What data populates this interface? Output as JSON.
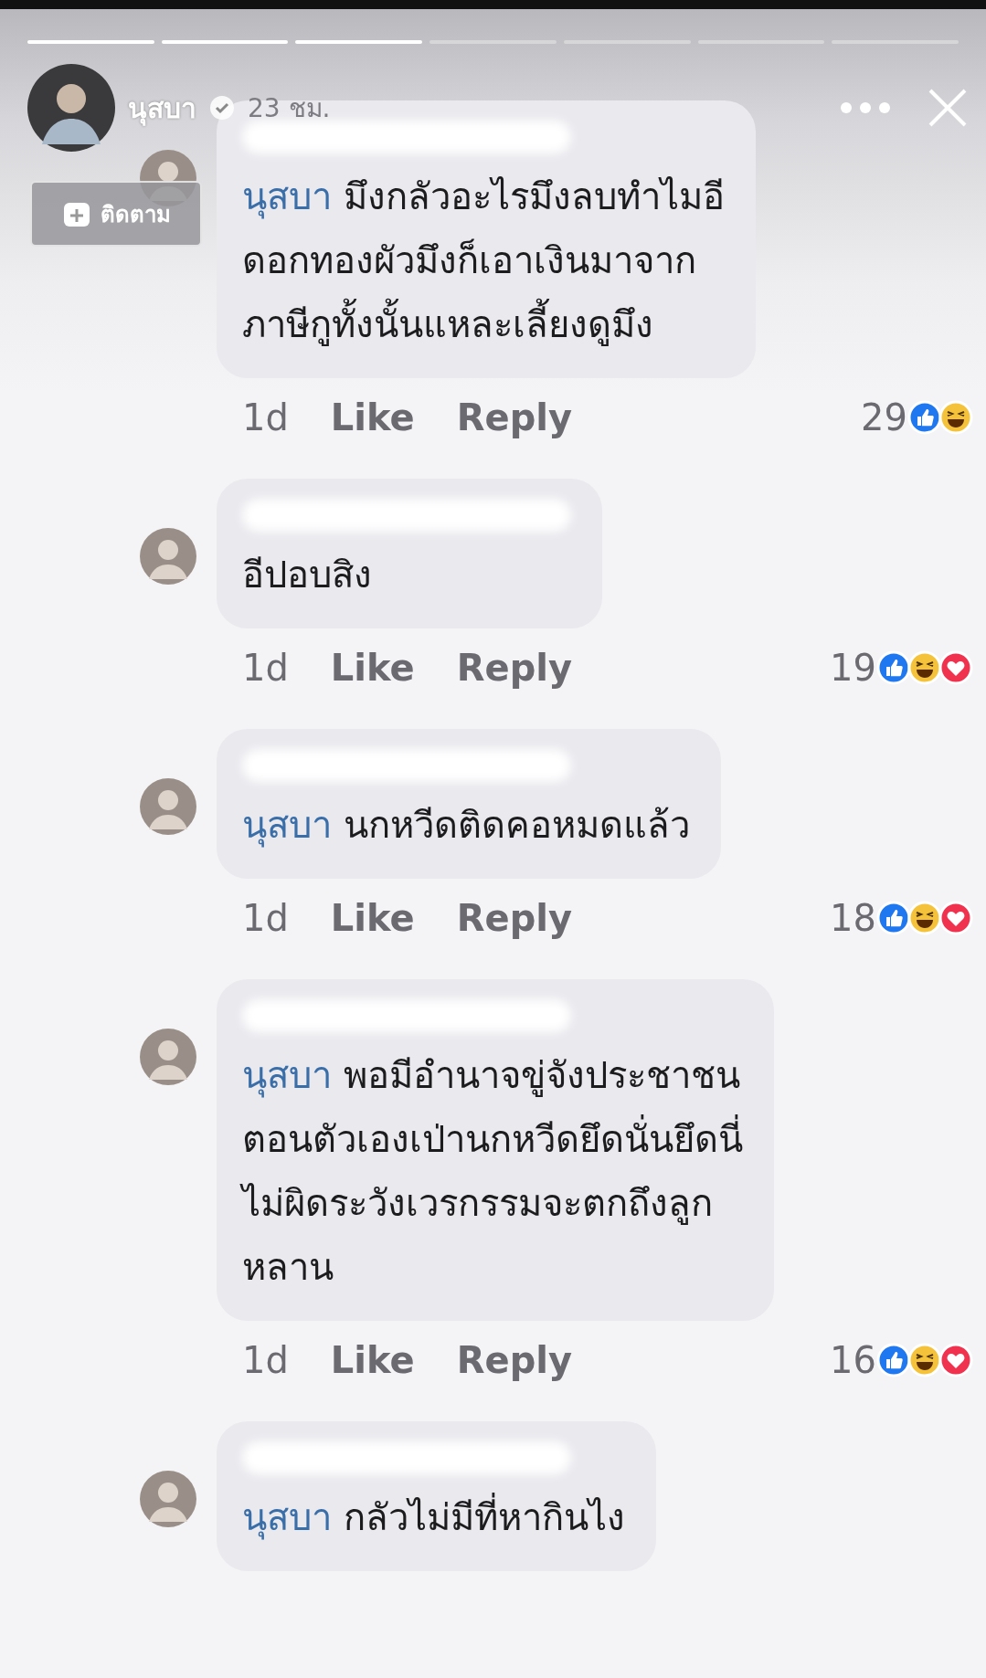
{
  "story": {
    "progress": [
      {
        "level": 1
      },
      {
        "level": 1
      },
      {
        "level": 1
      },
      {
        "level": 0
      },
      {
        "level": 0
      },
      {
        "level": 0
      },
      {
        "level": 0
      }
    ],
    "author": "นุสบา",
    "verified": true,
    "time": "23 ชม.",
    "follow_button": "ติดตาม"
  },
  "comments": [
    {
      "mention": "นุสบา",
      "lines": [
        "มึงกลัวอะไรมึงลบทำไมอี",
        "ดอกทองผัวมึงก็เอาเงินมาจาก",
        "ภาษีกูทั้งนั้นแหละเลี้ยงดูมึง"
      ],
      "meta": {
        "age": "1d",
        "like": "Like",
        "reply": "Reply",
        "count": "29",
        "reactions": [
          {
            "kind": "like"
          },
          {
            "kind": "haha"
          }
        ]
      }
    },
    {
      "lines": [
        "อีปอบสิง"
      ],
      "meta": {
        "age": "1d",
        "like": "Like",
        "reply": "Reply",
        "count": "19",
        "reactions": [
          {
            "kind": "like"
          },
          {
            "kind": "haha"
          },
          {
            "kind": "love"
          }
        ]
      }
    },
    {
      "mention": "นุสบา",
      "lines": [
        "นกหวีดติดคอหมดแล้ว"
      ],
      "meta": {
        "age": "1d",
        "like": "Like",
        "reply": "Reply",
        "count": "18",
        "reactions": [
          {
            "kind": "like"
          },
          {
            "kind": "haha"
          },
          {
            "kind": "love"
          }
        ]
      }
    },
    {
      "mention": "นุสบา",
      "lines": [
        "พอมีอำนาจขู่จังประชาชน",
        "ตอนตัวเองเป่านกหวีดยึดนั่นยึดนี่",
        "ไม่ผิดระวังเวรกรรมจะตกถึงลูก",
        "หลาน"
      ],
      "meta": {
        "age": "1d",
        "like": "Like",
        "reply": "Reply",
        "count": "16",
        "reactions": [
          {
            "kind": "like"
          },
          {
            "kind": "haha"
          },
          {
            "kind": "love"
          }
        ]
      }
    },
    {
      "mention": "นุสบา",
      "lines": [
        "กลัวไม่มีที่หากินไง"
      ]
    }
  ]
}
